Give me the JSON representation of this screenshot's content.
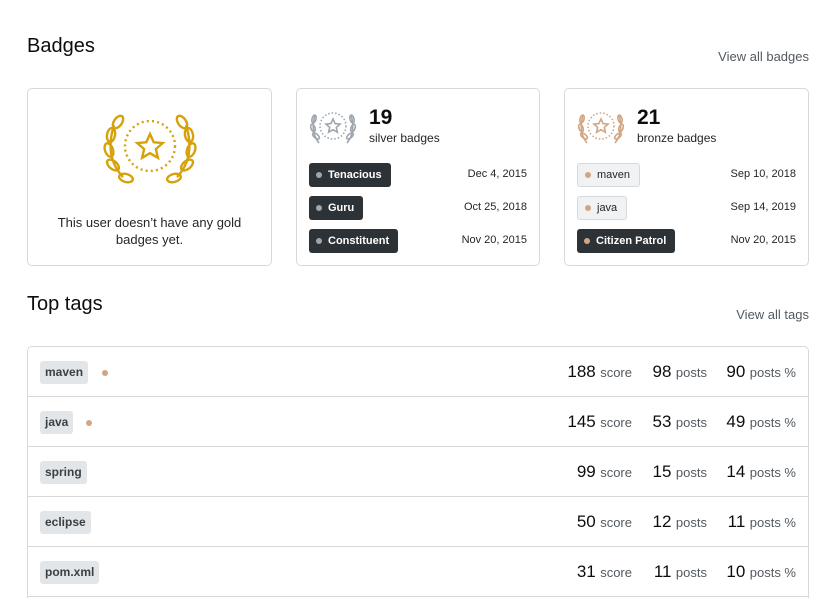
{
  "badges_section": {
    "title": "Badges",
    "view_all": "View all badges",
    "gold": {
      "empty_text": "This user doesn’t have any gold badges yet.",
      "icon": "laurel-star-icon",
      "color": "#d6a10a"
    },
    "silver": {
      "count": "19",
      "label": "silver badges",
      "icon": "laurel-star-icon",
      "color": "#9fa6ad",
      "items": [
        {
          "name": "Tenacious",
          "date": "Dec 4, 2015",
          "style": "dark"
        },
        {
          "name": "Guru",
          "date": "Oct 25, 2018",
          "style": "dark"
        },
        {
          "name": "Constituent",
          "date": "Nov 20, 2015",
          "style": "dark"
        }
      ]
    },
    "bronze": {
      "count": "21",
      "label": "bronze badges",
      "icon": "laurel-star-icon",
      "color": "#d1a684",
      "items": [
        {
          "name": "maven",
          "date": "Sep 10, 2018",
          "style": "light"
        },
        {
          "name": "java",
          "date": "Sep 14, 2019",
          "style": "light"
        },
        {
          "name": "Citizen Patrol",
          "date": "Nov 20, 2015",
          "style": "dark"
        }
      ]
    }
  },
  "tags_section": {
    "title": "Top tags",
    "view_all": "View all tags",
    "score_unit": "score",
    "posts_unit": "posts",
    "pct_unit": "posts %",
    "rows": [
      {
        "tag": "maven",
        "bronze": true,
        "score": "188",
        "posts": "98",
        "pct": "90"
      },
      {
        "tag": "java",
        "bronze": true,
        "score": "145",
        "posts": "53",
        "pct": "49"
      },
      {
        "tag": "spring",
        "bronze": false,
        "score": "99",
        "posts": "15",
        "pct": "14"
      },
      {
        "tag": "eclipse",
        "bronze": false,
        "score": "50",
        "posts": "12",
        "pct": "11"
      },
      {
        "tag": "pom.xml",
        "bronze": false,
        "score": "31",
        "posts": "11",
        "pct": "10"
      }
    ]
  }
}
